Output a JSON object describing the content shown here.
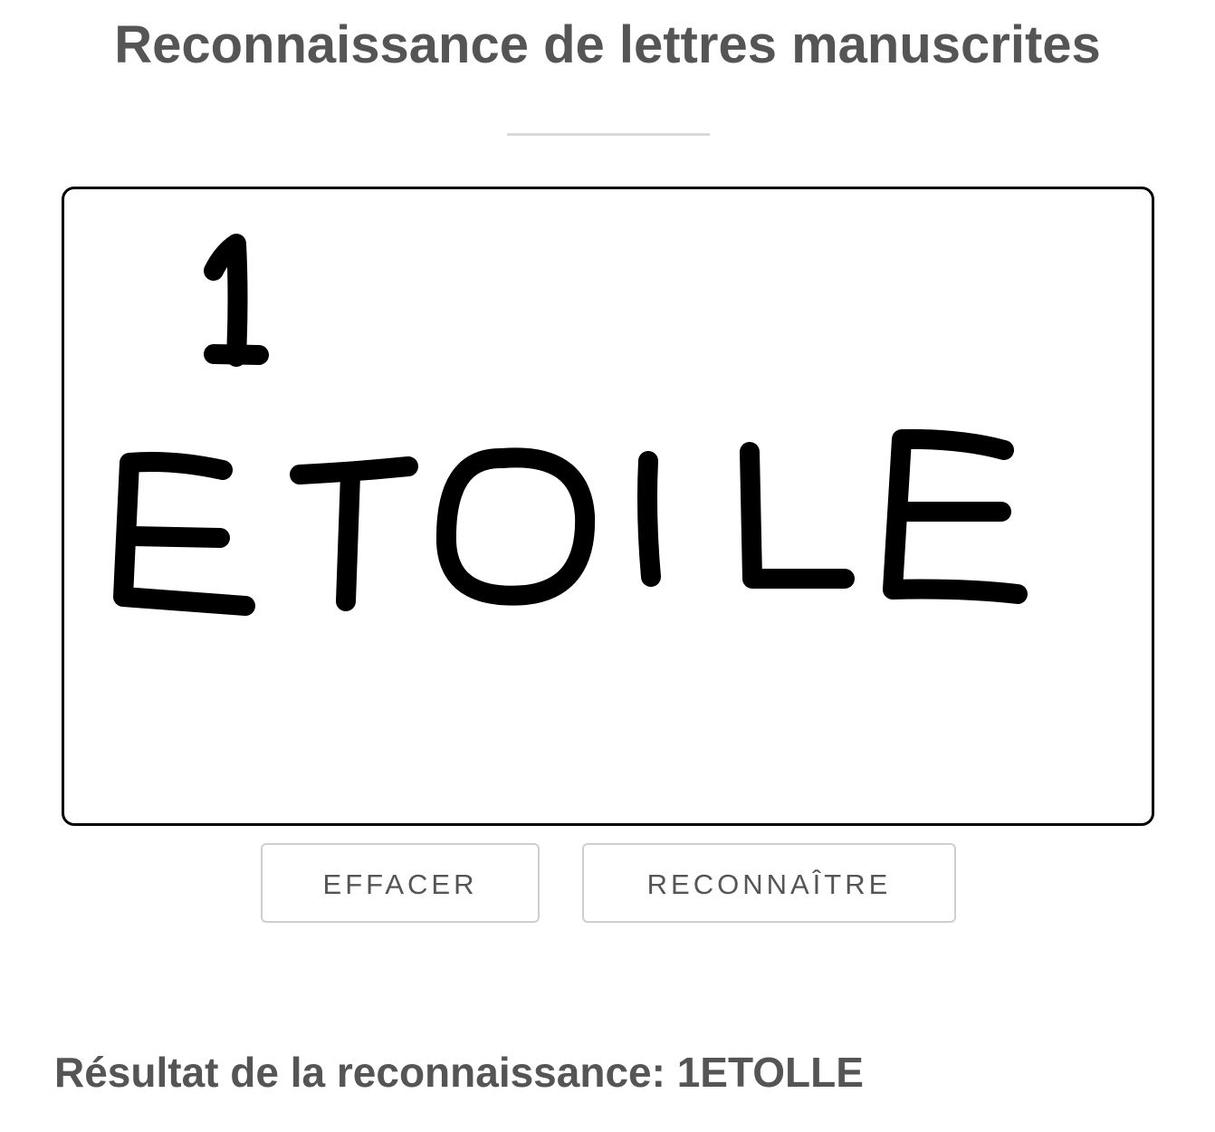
{
  "header": {
    "title": "Reconnaissance de lettres manuscrites"
  },
  "canvas": {
    "label": "drawing-canvas",
    "stroke_color": "#000000",
    "border_color": "#000000"
  },
  "buttons": {
    "clear_label": "EFFACER",
    "recognize_label": "RECONNAÎTRE"
  },
  "result": {
    "prefix": "Résultat de la reconnaissance: ",
    "value": "1ETOLLE"
  }
}
